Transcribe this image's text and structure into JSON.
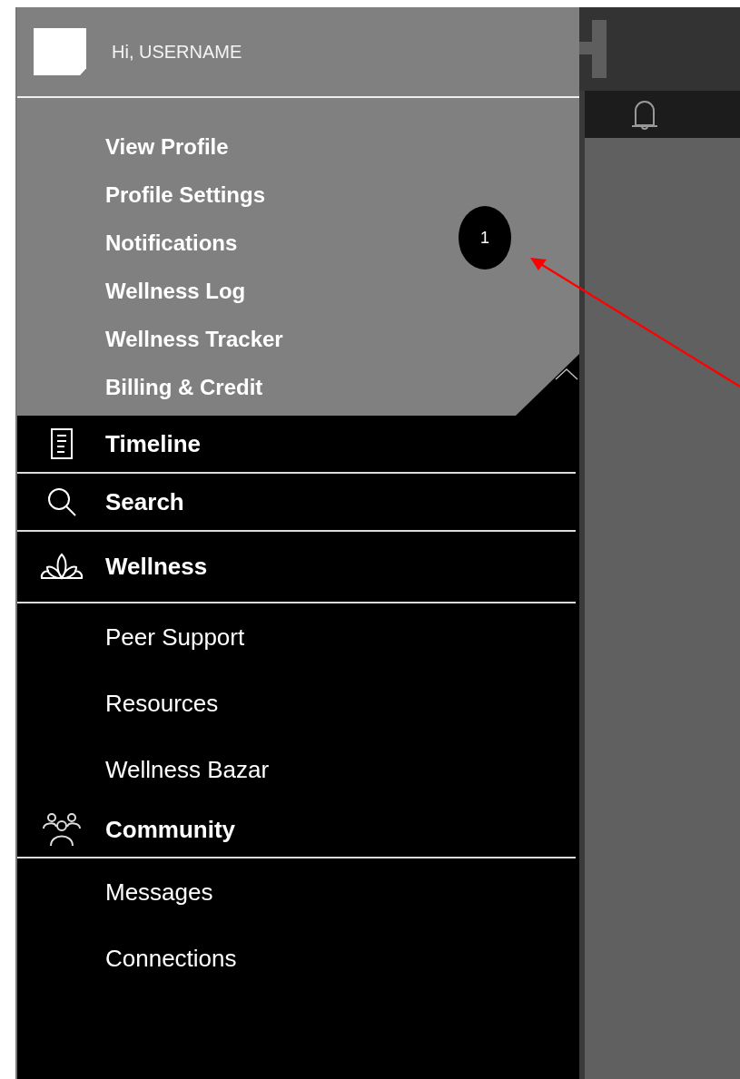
{
  "profile": {
    "greeting": "Hi, USERNAME",
    "expanded": true,
    "items": [
      {
        "label": "View Profile"
      },
      {
        "label": "Profile Settings"
      },
      {
        "label": "Notifications"
      },
      {
        "label": "Wellness Log"
      },
      {
        "label": "Wellness Tracker"
      },
      {
        "label": "Billing & Credit"
      }
    ]
  },
  "nav": [
    {
      "label": "Timeline"
    },
    {
      "label": "Search"
    },
    {
      "label": "Wellness",
      "children": [
        {
          "label": "Peer Support"
        },
        {
          "label": "Resources"
        },
        {
          "label": "Wellness Bazar"
        }
      ]
    },
    {
      "label": "Community",
      "children": [
        {
          "label": "Messages"
        },
        {
          "label": "Connections"
        }
      ]
    }
  ],
  "annotation": {
    "number": "1"
  }
}
